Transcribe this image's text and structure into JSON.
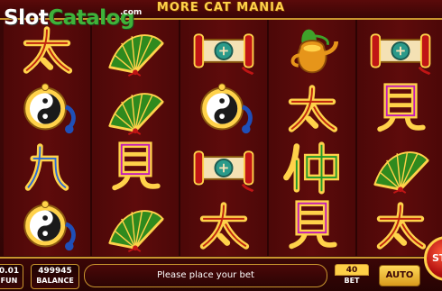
{
  "game": {
    "title": "MORE CAT MANIA"
  },
  "watermark": {
    "brand_first": "Slot",
    "brand_second": "Catalog",
    "suffix": ".com"
  },
  "reels": [
    [
      "glyph-tai",
      "yin-yang-amulet",
      "glyph-jiu",
      "yin-yang-amulet"
    ],
    [
      "green-fan",
      "green-fan",
      "glyph-jian",
      "green-fan"
    ],
    [
      "red-scroll",
      "yin-yang-amulet",
      "red-scroll",
      "glyph-tai"
    ],
    [
      "golden-teapot",
      "glyph-tai",
      "glyph-zhong",
      "glyph-jian"
    ],
    [
      "red-scroll",
      "glyph-jian",
      "green-fan",
      "glyph-tai"
    ]
  ],
  "bottom_bar": {
    "coin_value": "0.01",
    "coin_label": "FUN",
    "balance_value": "499945",
    "balance_label": "BALANCE",
    "message": "Please place your bet",
    "bet_value": "40",
    "bet_label": "BET",
    "auto_label": "AUTO",
    "spin_label": "ST"
  },
  "colors": {
    "gold": "#ffd24a",
    "frame": "#c9952e",
    "background": "#420808"
  }
}
